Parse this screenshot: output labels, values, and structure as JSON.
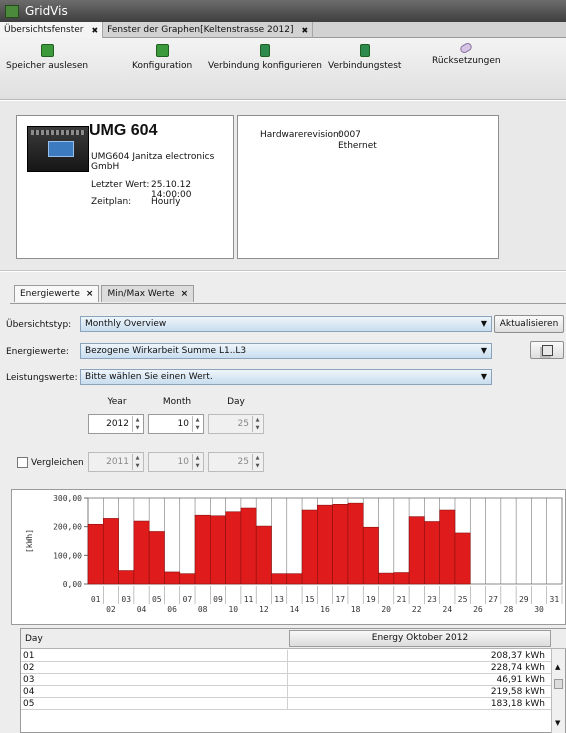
{
  "app": {
    "title": "GridVis"
  },
  "tabs": [
    {
      "label": "Übersichtsfenster"
    },
    {
      "label": "Fenster der Graphen[Keltenstrasse 2012]"
    }
  ],
  "toolbar": {
    "items": [
      {
        "label": "Speicher auslesen",
        "icon": "memory-icon"
      },
      {
        "label": "Konfiguration",
        "icon": "config-icon"
      },
      {
        "label": "Verbindung konfigurieren",
        "icon": "connection-icon"
      },
      {
        "label": "Verbindungstest",
        "icon": "test-icon"
      },
      {
        "label": "Rücksetzungen",
        "icon": "eraser-icon"
      }
    ]
  },
  "device": {
    "name": "UMG 604",
    "description": "UMG604 Janitza electronics GmbH",
    "last_value_label": "Letzter Wert:",
    "last_value": "25.10.12 14:00:00",
    "schedule_label": "Zeitplan:",
    "schedule": "Hourly",
    "hardware_label": "Hardwarerevision:",
    "hardware_value": "0007",
    "hardware_conn": "Ethernet"
  },
  "subtabs": [
    {
      "label": "Energiewerte"
    },
    {
      "label": "Min/Max Werte"
    }
  ],
  "form": {
    "overview_label": "Übersichtstyp:",
    "overview_value": "Monthly Overview",
    "energy_label": "Energiewerte:",
    "energy_value": "Bezogene Wirkarbeit Summe L1..L3",
    "power_label": "Leistungswerte:",
    "power_value": "Bitte wählen Sie einen Wert.",
    "refresh_label": "Aktualisieren",
    "year_label": "Year",
    "month_label": "Month",
    "day_label": "Day",
    "year": "2012",
    "month": "10",
    "day": "25",
    "compare_label": "Vergleichen",
    "compare_year": "2011",
    "compare_month": "10",
    "compare_day": "25"
  },
  "chart_data": {
    "type": "bar",
    "ylabel": "[kWh]",
    "ylim": [
      0,
      300
    ],
    "yticks": [
      "300,00",
      "200,00",
      "100,00",
      "0,00"
    ],
    "categories": [
      "01",
      "02",
      "03",
      "04",
      "05",
      "06",
      "07",
      "08",
      "09",
      "10",
      "11",
      "12",
      "13",
      "14",
      "15",
      "16",
      "17",
      "18",
      "19",
      "20",
      "21",
      "22",
      "23",
      "24",
      "25",
      "26",
      "27",
      "28",
      "29",
      "30",
      "31"
    ],
    "values": [
      208.37,
      228.74,
      46.91,
      219.58,
      183.18,
      42,
      36,
      240,
      238,
      252,
      265,
      202,
      36,
      36,
      258,
      275,
      278,
      282,
      198,
      38,
      40,
      235,
      218,
      258,
      178,
      0,
      0,
      0,
      0,
      0,
      0
    ],
    "color": "#e01b1b",
    "grid": true
  },
  "table": {
    "col_day": "Day",
    "col_energy": "Energy Oktober 2012",
    "rows": [
      {
        "day": "01",
        "value": "208,37 kWh"
      },
      {
        "day": "02",
        "value": "228,74 kWh"
      },
      {
        "day": "03",
        "value": "46,91 kWh"
      },
      {
        "day": "04",
        "value": "219,58 kWh"
      },
      {
        "day": "05",
        "value": "183,18 kWh"
      }
    ]
  }
}
